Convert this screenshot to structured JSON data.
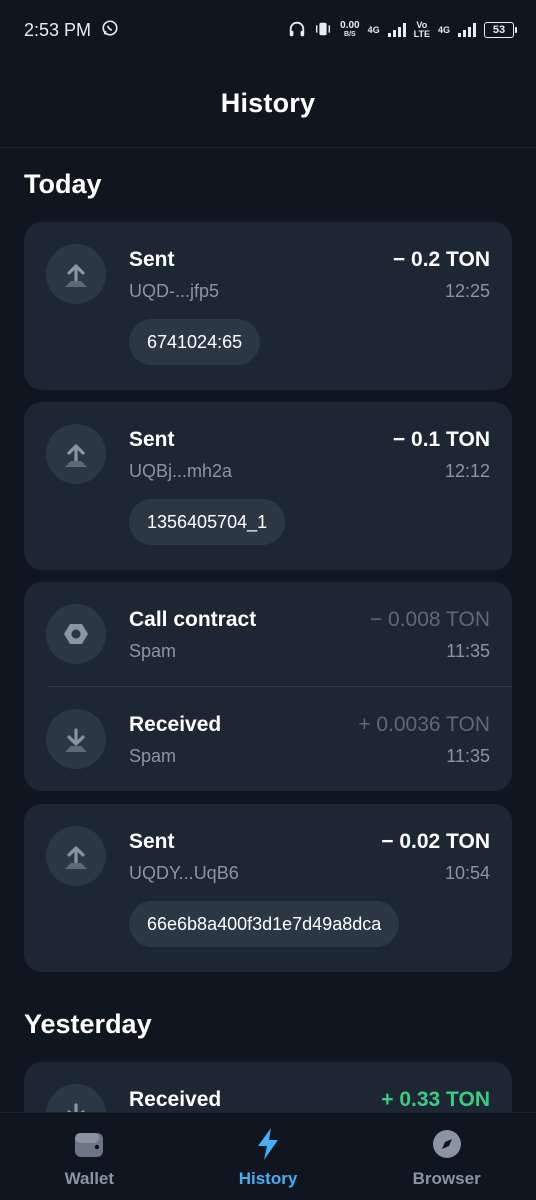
{
  "status_bar": {
    "time": "2:53 PM",
    "net_speed": "0.00",
    "net_unit": "B/S",
    "sim1": "4G",
    "volte_top": "Vo",
    "volte_bottom": "LTE",
    "sim2": "4G",
    "battery": "53",
    "icons": [
      "whatsapp-icon",
      "headphones-icon",
      "vibrate-icon",
      "signal-icon"
    ]
  },
  "header": {
    "title": "History"
  },
  "sections": [
    {
      "title": "Today",
      "cards": [
        {
          "items": [
            {
              "type": "sent",
              "title": "Sent",
              "address": "UQD-...jfp5",
              "amount": "− 0.2 TON",
              "time": "12:25",
              "comment": "6741024:65"
            }
          ]
        },
        {
          "items": [
            {
              "type": "sent",
              "title": "Sent",
              "address": "UQBj...mh2a",
              "amount": "− 0.1 TON",
              "time": "12:12",
              "comment": "1356405704_1"
            }
          ]
        },
        {
          "items": [
            {
              "type": "contract",
              "title": "Call contract",
              "address": "Spam",
              "amount": "− 0.008 TON",
              "time": "11:35"
            },
            {
              "type": "received",
              "title": "Received",
              "address": "Spam",
              "amount": "+ 0.0036 TON",
              "time": "11:35"
            }
          ]
        },
        {
          "items": [
            {
              "type": "sent",
              "title": "Sent",
              "address": "UQDY...UqB6",
              "amount": "− 0.02 TON",
              "time": "10:54",
              "comment": "66e6b8a400f3d1e7d49a8dca"
            }
          ]
        }
      ]
    },
    {
      "title": "Yesterday",
      "cards": [
        {
          "items": [
            {
              "type": "received",
              "title": "Received",
              "amount": "+ 0.33 TON"
            }
          ]
        }
      ]
    }
  ],
  "tabs": [
    {
      "label": "Wallet",
      "icon": "wallet-icon",
      "active": false
    },
    {
      "label": "History",
      "icon": "lightning-icon",
      "active": true
    },
    {
      "label": "Browser",
      "icon": "compass-icon",
      "active": false
    }
  ],
  "colors": {
    "background": "#10161f",
    "card": "#1d2633",
    "accent": "#45aef5",
    "green": "#39cc83",
    "muted": "#8a94a3"
  }
}
